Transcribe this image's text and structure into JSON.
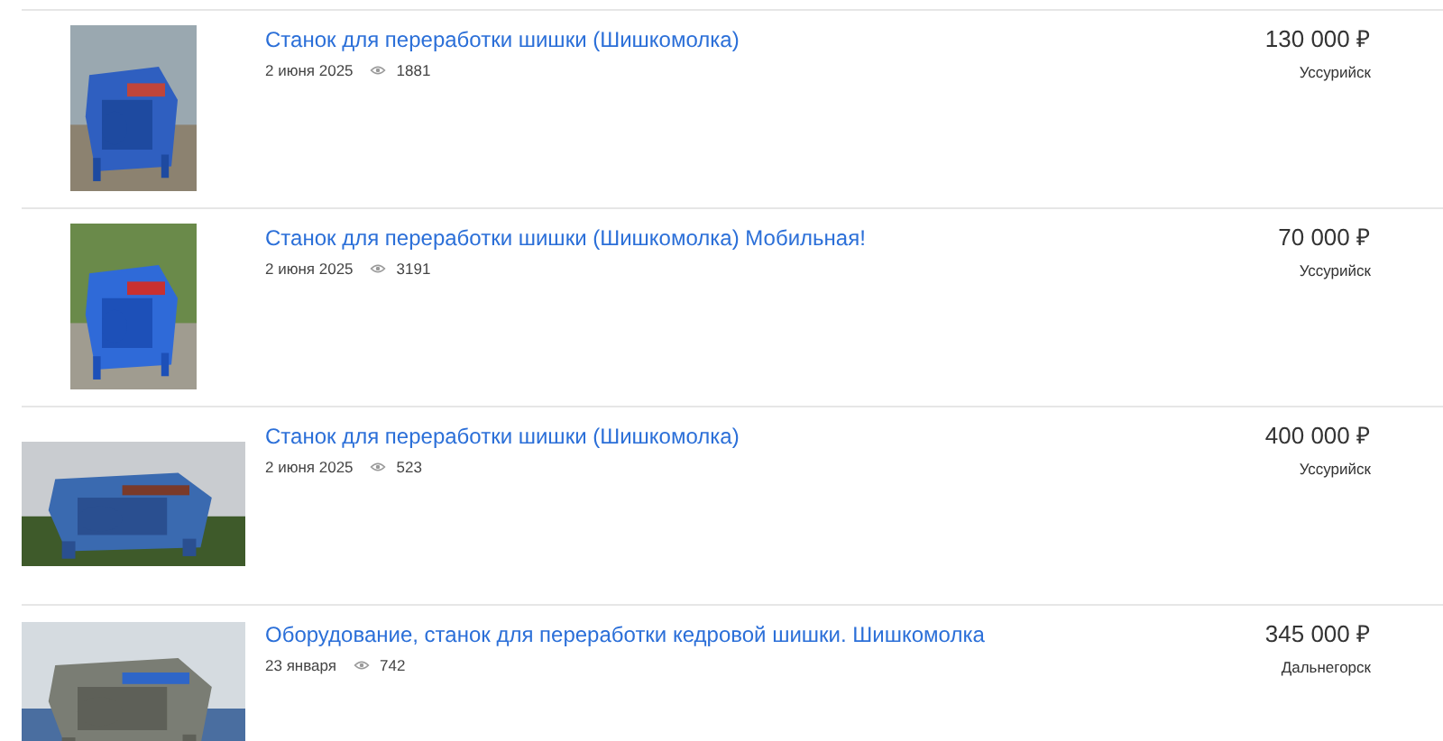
{
  "listings": [
    {
      "title": "Станок для переработки шишки (Шишкомолка)",
      "date": "2 июня 2025",
      "views": "1881",
      "price": "130 000 ₽",
      "city": "Уссурийск"
    },
    {
      "title": "Станок для переработки шишки (Шишкомолка) Мобильная!",
      "date": "2 июня 2025",
      "views": "3191",
      "price": "70 000 ₽",
      "city": "Уссурийск"
    },
    {
      "title": "Станок для переработки шишки (Шишкомолка)",
      "date": "2 июня 2025",
      "views": "523",
      "price": "400 000 ₽",
      "city": "Уссурийск"
    },
    {
      "title": "Оборудование, станок для переработки кедровой шишки. Шишкомолка",
      "date": "23 января",
      "views": "742",
      "price": "345 000 ₽",
      "city": "Дальнегорск"
    }
  ]
}
